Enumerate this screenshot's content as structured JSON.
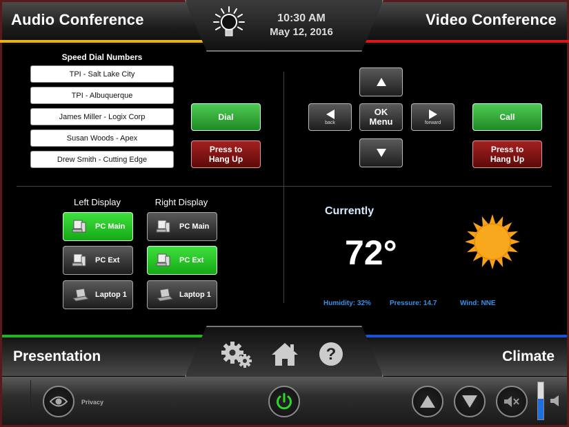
{
  "header": {
    "audio_conference": "Audio Conference",
    "video_conference": "Video Conference",
    "time": "10:30 AM",
    "date": "May 12, 2016"
  },
  "speed_dial": {
    "title": "Speed Dial Numbers",
    "items": [
      "TPI - Salt Lake City",
      "TPI - Albuquerque",
      "James Miller - Logix Corp",
      "Susan Woods - Apex",
      "Drew Smith - Cutting Edge"
    ],
    "dial_label": "Dial",
    "hangup_label": "Press to Hang Up"
  },
  "video": {
    "ok_menu_label": "OK Menu",
    "back_label": "back",
    "forward_label": "forward",
    "call_label": "Call",
    "hangup_label": "Press to Hang Up"
  },
  "displays": {
    "left_title": "Left Display",
    "right_title": "Right Display",
    "left": [
      {
        "label": "PC Main",
        "icon": "pc-icon",
        "active": true
      },
      {
        "label": "PC Ext",
        "icon": "pc-icon",
        "active": false
      },
      {
        "label": "Laptop 1",
        "icon": "laptop-icon",
        "active": false
      }
    ],
    "right": [
      {
        "label": "PC Main",
        "icon": "pc-icon",
        "active": false
      },
      {
        "label": "PC Ext",
        "icon": "pc-icon",
        "active": true
      },
      {
        "label": "Laptop 1",
        "icon": "laptop-icon",
        "active": false
      }
    ]
  },
  "weather": {
    "currently": "Currently",
    "temperature": "72°",
    "humidity": "Humidity: 32%",
    "pressure": "Pressure: 14.7",
    "wind": "Wind: NNE",
    "icon": "sun-icon"
  },
  "bottom": {
    "presentation": "Presentation",
    "climate": "Climate",
    "privacy": "Privacy",
    "volume_level": 0.55
  },
  "colors": {
    "audio_accent": "#e8b11c",
    "video_accent": "#d51818",
    "presentation_accent": "#22b322",
    "climate_accent": "#1d4fd8",
    "active_green": "#2ed62e",
    "weather_text": "#3a8fe8"
  }
}
